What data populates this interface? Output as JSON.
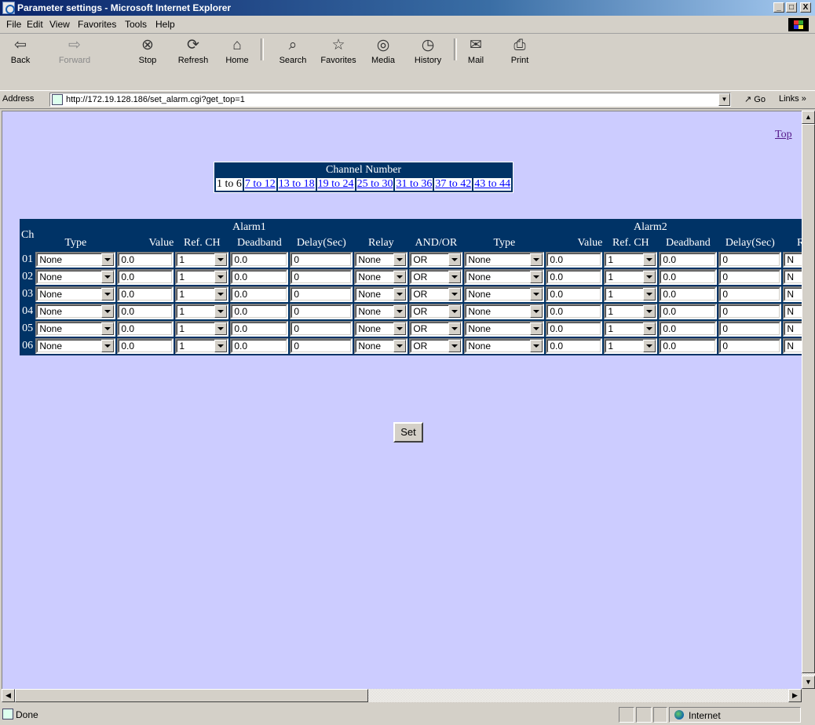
{
  "window": {
    "title": "Parameter settings - Microsoft Internet Explorer",
    "controls": [
      "_",
      "□",
      "X"
    ]
  },
  "menu": [
    "File",
    "Edit",
    "View",
    "Favorites",
    "Tools",
    "Help"
  ],
  "toolbar": {
    "back": "Back",
    "forward": "Forward",
    "stop": "Stop",
    "refresh": "Refresh",
    "home": "Home",
    "search": "Search",
    "favorites": "Favorites",
    "media": "Media",
    "history": "History",
    "mail": "Mail",
    "print": "Print"
  },
  "address": {
    "label": "Address",
    "url": "http://172.19.128.186/set_alarm.cgi?get_top=1",
    "go": "Go",
    "links": "Links"
  },
  "page": {
    "top_link": "Top",
    "channel_number_title": "Channel Number",
    "channel_ranges": [
      "1 to 6",
      "7 to 12",
      "13 to 18",
      "19 to 24",
      "25 to 30",
      "31 to 36",
      "37 to 42",
      "43 to 44"
    ],
    "current_range": "1 to 6",
    "ch_header": "Ch",
    "alarm1_title": "Alarm1",
    "alarm2_title": "Alarm2",
    "columns_alarm1": [
      "Type",
      "Value",
      "Ref. CH",
      "Deadband",
      "Delay(Sec)",
      "Relay",
      "AND/OR"
    ],
    "columns_alarm2": [
      "Type",
      "Value",
      "Ref. CH",
      "Deadband",
      "Delay(Sec)",
      "Relay"
    ],
    "rows": [
      {
        "ch": "01",
        "a1": {
          "type": "None",
          "value": "0.0",
          "ref_ch": "1",
          "deadband": "0.0",
          "delay": "0",
          "relay": "None",
          "and_or": "OR"
        },
        "a2": {
          "type": "None",
          "value": "0.0",
          "ref_ch": "1",
          "deadband": "0.0",
          "delay": "0",
          "relay": "N"
        }
      },
      {
        "ch": "02",
        "a1": {
          "type": "None",
          "value": "0.0",
          "ref_ch": "1",
          "deadband": "0.0",
          "delay": "0",
          "relay": "None",
          "and_or": "OR"
        },
        "a2": {
          "type": "None",
          "value": "0.0",
          "ref_ch": "1",
          "deadband": "0.0",
          "delay": "0",
          "relay": "N"
        }
      },
      {
        "ch": "03",
        "a1": {
          "type": "None",
          "value": "0.0",
          "ref_ch": "1",
          "deadband": "0.0",
          "delay": "0",
          "relay": "None",
          "and_or": "OR"
        },
        "a2": {
          "type": "None",
          "value": "0.0",
          "ref_ch": "1",
          "deadband": "0.0",
          "delay": "0",
          "relay": "N"
        }
      },
      {
        "ch": "04",
        "a1": {
          "type": "None",
          "value": "0.0",
          "ref_ch": "1",
          "deadband": "0.0",
          "delay": "0",
          "relay": "None",
          "and_or": "OR"
        },
        "a2": {
          "type": "None",
          "value": "0.0",
          "ref_ch": "1",
          "deadband": "0.0",
          "delay": "0",
          "relay": "N"
        }
      },
      {
        "ch": "05",
        "a1": {
          "type": "None",
          "value": "0.0",
          "ref_ch": "1",
          "deadband": "0.0",
          "delay": "0",
          "relay": "None",
          "and_or": "OR"
        },
        "a2": {
          "type": "None",
          "value": "0.0",
          "ref_ch": "1",
          "deadband": "0.0",
          "delay": "0",
          "relay": "N"
        }
      },
      {
        "ch": "06",
        "a1": {
          "type": "None",
          "value": "0.0",
          "ref_ch": "1",
          "deadband": "0.0",
          "delay": "0",
          "relay": "None",
          "and_or": "OR"
        },
        "a2": {
          "type": "None",
          "value": "0.0",
          "ref_ch": "1",
          "deadband": "0.0",
          "delay": "0",
          "relay": "N"
        }
      }
    ],
    "set_button": "Set"
  },
  "status": {
    "text": "Done",
    "zone": "Internet"
  },
  "colors": {
    "page_background": "#ccccff",
    "table_header": "#003366",
    "titlebar": "#0a246a"
  }
}
